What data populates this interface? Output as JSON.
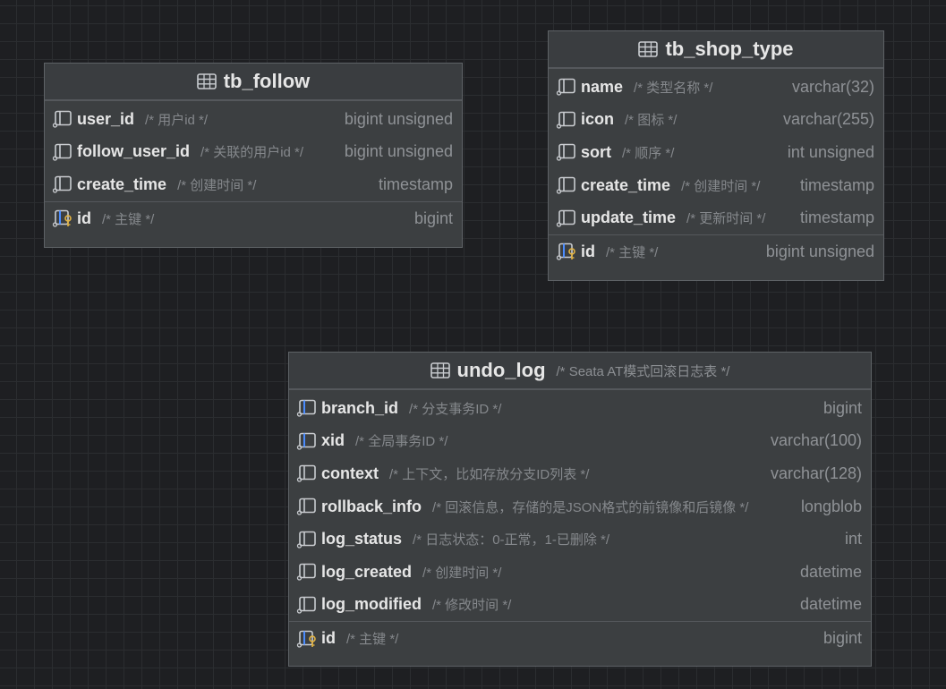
{
  "tables": {
    "tb_follow": {
      "name": "tb_follow",
      "columns": [
        {
          "name": "user_id",
          "comment": "/* 用户id */",
          "type": "bigint unsigned"
        },
        {
          "name": "follow_user_id",
          "comment": "/* 关联的用户id */",
          "type": "bigint unsigned"
        },
        {
          "name": "create_time",
          "comment": "/* 创建时间 */",
          "type": "timestamp"
        }
      ],
      "key": {
        "name": "id",
        "comment": "/* 主键 */",
        "type": "bigint"
      }
    },
    "tb_shop_type": {
      "name": "tb_shop_type",
      "columns": [
        {
          "name": "name",
          "comment": "/* 类型名称 */",
          "type": "varchar(32)"
        },
        {
          "name": "icon",
          "comment": "/* 图标 */",
          "type": "varchar(255)"
        },
        {
          "name": "sort",
          "comment": "/* 顺序 */",
          "type": "int unsigned"
        },
        {
          "name": "create_time",
          "comment": "/* 创建时间 */",
          "type": "timestamp"
        },
        {
          "name": "update_time",
          "comment": "/* 更新时间 */",
          "type": "timestamp"
        }
      ],
      "key": {
        "name": "id",
        "comment": "/* 主键 */",
        "type": "bigint unsigned"
      }
    },
    "undo_log": {
      "name": "undo_log",
      "comment": "/* Seata AT模式回滚日志表 */",
      "columns": [
        {
          "name": "branch_id",
          "comment": "/* 分支事务ID */",
          "type": "bigint"
        },
        {
          "name": "xid",
          "comment": "/* 全局事务ID */",
          "type": "varchar(100)"
        },
        {
          "name": "context",
          "comment": "/* 上下文，比如存放分支ID列表 */",
          "type": "varchar(128)"
        },
        {
          "name": "rollback_info",
          "comment": "/* 回滚信息，存储的是JSON格式的前镜像和后镜像 */",
          "type": "longblob"
        },
        {
          "name": "log_status",
          "comment": "/* 日志状态：0-正常，1-已删除 */",
          "type": "int"
        },
        {
          "name": "log_created",
          "comment": "/* 创建时间 */",
          "type": "datetime"
        },
        {
          "name": "log_modified",
          "comment": "/* 修改时间 */",
          "type": "datetime"
        }
      ],
      "key": {
        "name": "id",
        "comment": "/* 主键 */",
        "type": "bigint"
      }
    }
  },
  "icons": {
    "table": "table-icon",
    "column": "column-icon",
    "indexed_column": "indexed-column-icon",
    "primary_key": "primary-key-icon"
  },
  "colors": {
    "canvas": "#1e1f22",
    "table_bg": "#3c3f41",
    "index_blue": "#4a8cff",
    "key_gold": "#e3b341"
  }
}
